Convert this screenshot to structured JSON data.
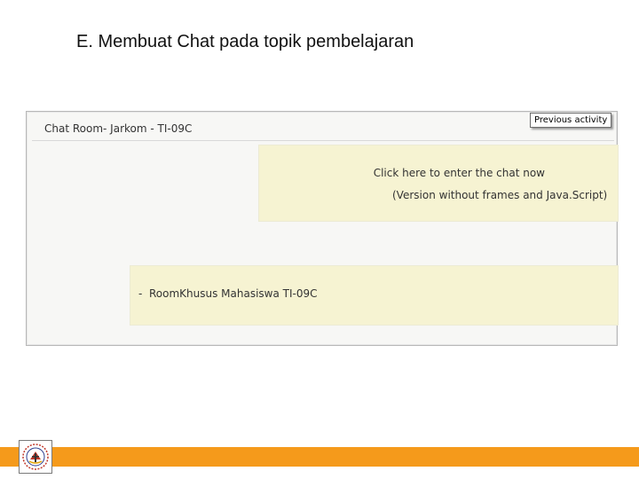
{
  "slide": {
    "title": "E. Membuat Chat pada topik pembelajaran"
  },
  "chat_page": {
    "heading": "Chat Room- Jarkom - TI-09C",
    "previous_activity_label": "Previous activity",
    "enter_chat_link": "Click here to enter the chat now",
    "noframes_link": "(Version without frames and Java.Script)",
    "room_bullet": "-",
    "rooms": [
      "RoomKhusus Mahasiswa TI-09C"
    ]
  },
  "colors": {
    "footer_accent": "#f59a1b",
    "highlight_box": "#f6f3d2"
  },
  "icons": {
    "logo": "institution-emblem-icon"
  }
}
